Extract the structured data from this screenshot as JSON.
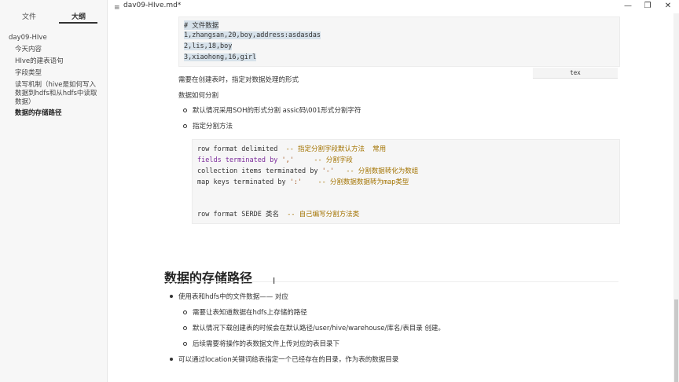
{
  "window": {
    "title": "dav09-HIve.md*",
    "menu_glyph": "≡",
    "minimize_glyph": "—",
    "maximize_glyph": "❐",
    "close_glyph": "✕"
  },
  "sidebar": {
    "tabs": [
      "文件",
      "大纲"
    ],
    "outline": [
      {
        "label": "day09-HIve"
      },
      {
        "label": "今天内容"
      },
      {
        "label": "HIve的建表语句"
      },
      {
        "label": "字段类型"
      },
      {
        "label": "读写机制（hive是如何写入数据到hdfs和从hdfs中读取数据）"
      },
      {
        "label": "数据的存储路径"
      }
    ]
  },
  "content": {
    "code1": {
      "lines": [
        "# 文件数据",
        "1,zhangsan,20,boy,address:asdasdas",
        "2,lis,18,boy",
        "3,xiaohong,16,girl"
      ],
      "lang": "tex"
    },
    "para1": "需要在创建表时，指定对数据处理的形式",
    "para2": "数据如何分割",
    "bullets1": [
      "默认情况采用SOH的形式分割  assic码\\001形式分割字符",
      "指定分割方法"
    ],
    "code2": {
      "l1_a": "row format delimited  ",
      "l1_c": "-- 指定分割字段默认方法  常用",
      "l2_a": "fields terminated by ",
      "l2_s": "','",
      "l2_c": "     -- 分割字段",
      "l3_a": "collection items terminated by ",
      "l3_s": "'-'",
      "l3_c": "   -- 分割数据转化为数组",
      "l4_a": "map keys terminated by ",
      "l4_s": "':'",
      "l4_c": "    -- 分割数据数据转为map类型",
      "l5_a": "row format SERDE 类名  ",
      "l5_c": "-- 自己编写分割方法类"
    },
    "heading": "数据的存储路径",
    "cursor_glyph": "I",
    "list": [
      "使用表和hdfs中的文件数据—— 对应",
      "需要让表知道数据在hdfs上存储的路径",
      "默认情况下载创建表的时候会在默认路径/user/hive/warehouse/库名/表目录  创建。",
      "后续需要将操作的表数据文件上传对应的表目录下",
      "可以通过location关键词给表指定一个已经存在的目录，作为表的数据目录"
    ]
  }
}
